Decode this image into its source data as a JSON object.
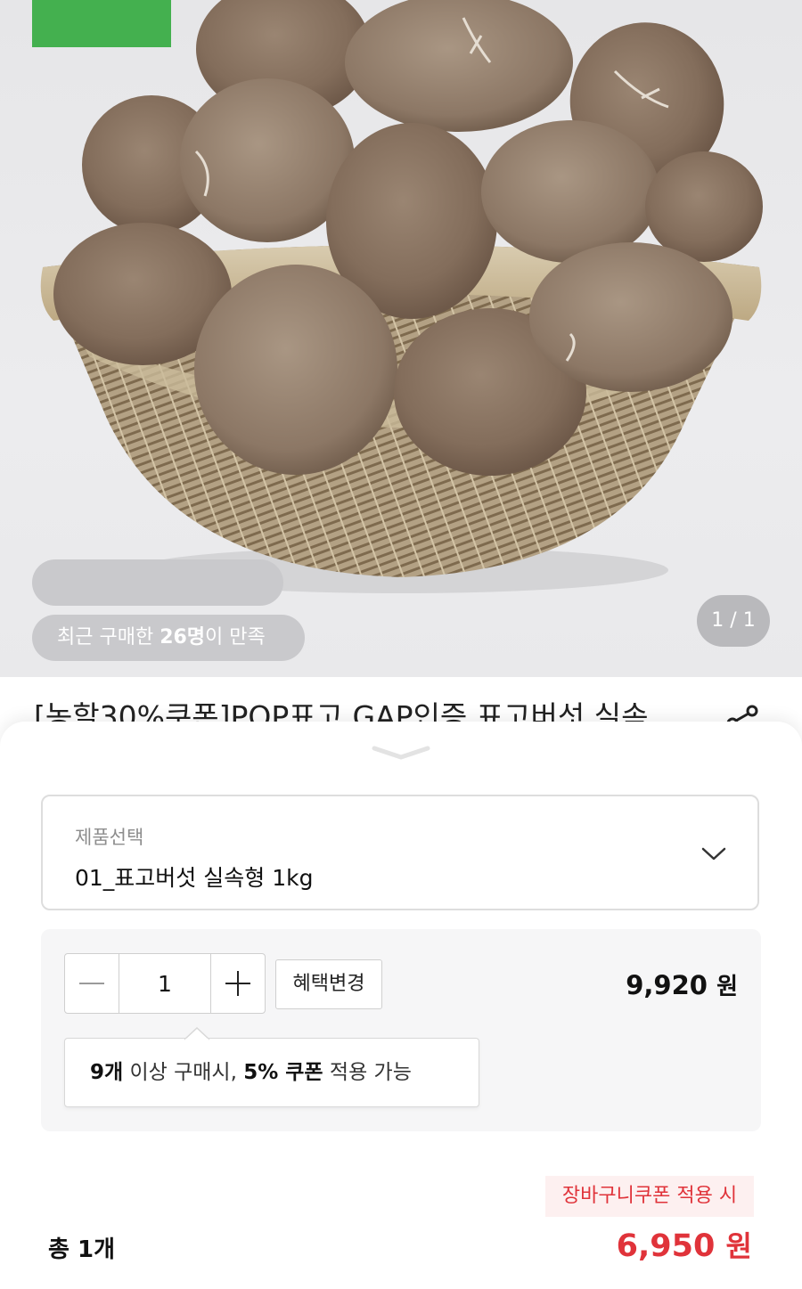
{
  "hero": {
    "recent_purchase_prefix": "최근 구매한 ",
    "recent_purchase_count": "26명",
    "recent_purchase_suffix": "이 만족",
    "page_indicator": "1 / 1"
  },
  "product": {
    "title": "[농할30%쿠폰]POP표고 GAP인증 표고버섯 실속"
  },
  "sheet": {
    "option": {
      "label": "제품선택",
      "value": "01_표고버섯 실속형 1kg"
    },
    "quantity": "1",
    "benefit_button": "혜택변경",
    "item_price": "9,920",
    "item_price_unit": "원",
    "tooltip": {
      "count": "9개",
      "middle": " 이상 구매시, ",
      "discount": "5% 쿠폰",
      "suffix": " 적용 가능"
    },
    "coupon_label": "장바구니쿠폰 적용 시",
    "total_count": "총 1개",
    "total_price": "6,950",
    "total_price_unit": "원"
  },
  "colors": {
    "accent_red": "#e0333a",
    "badge_green": "#44b04f"
  }
}
